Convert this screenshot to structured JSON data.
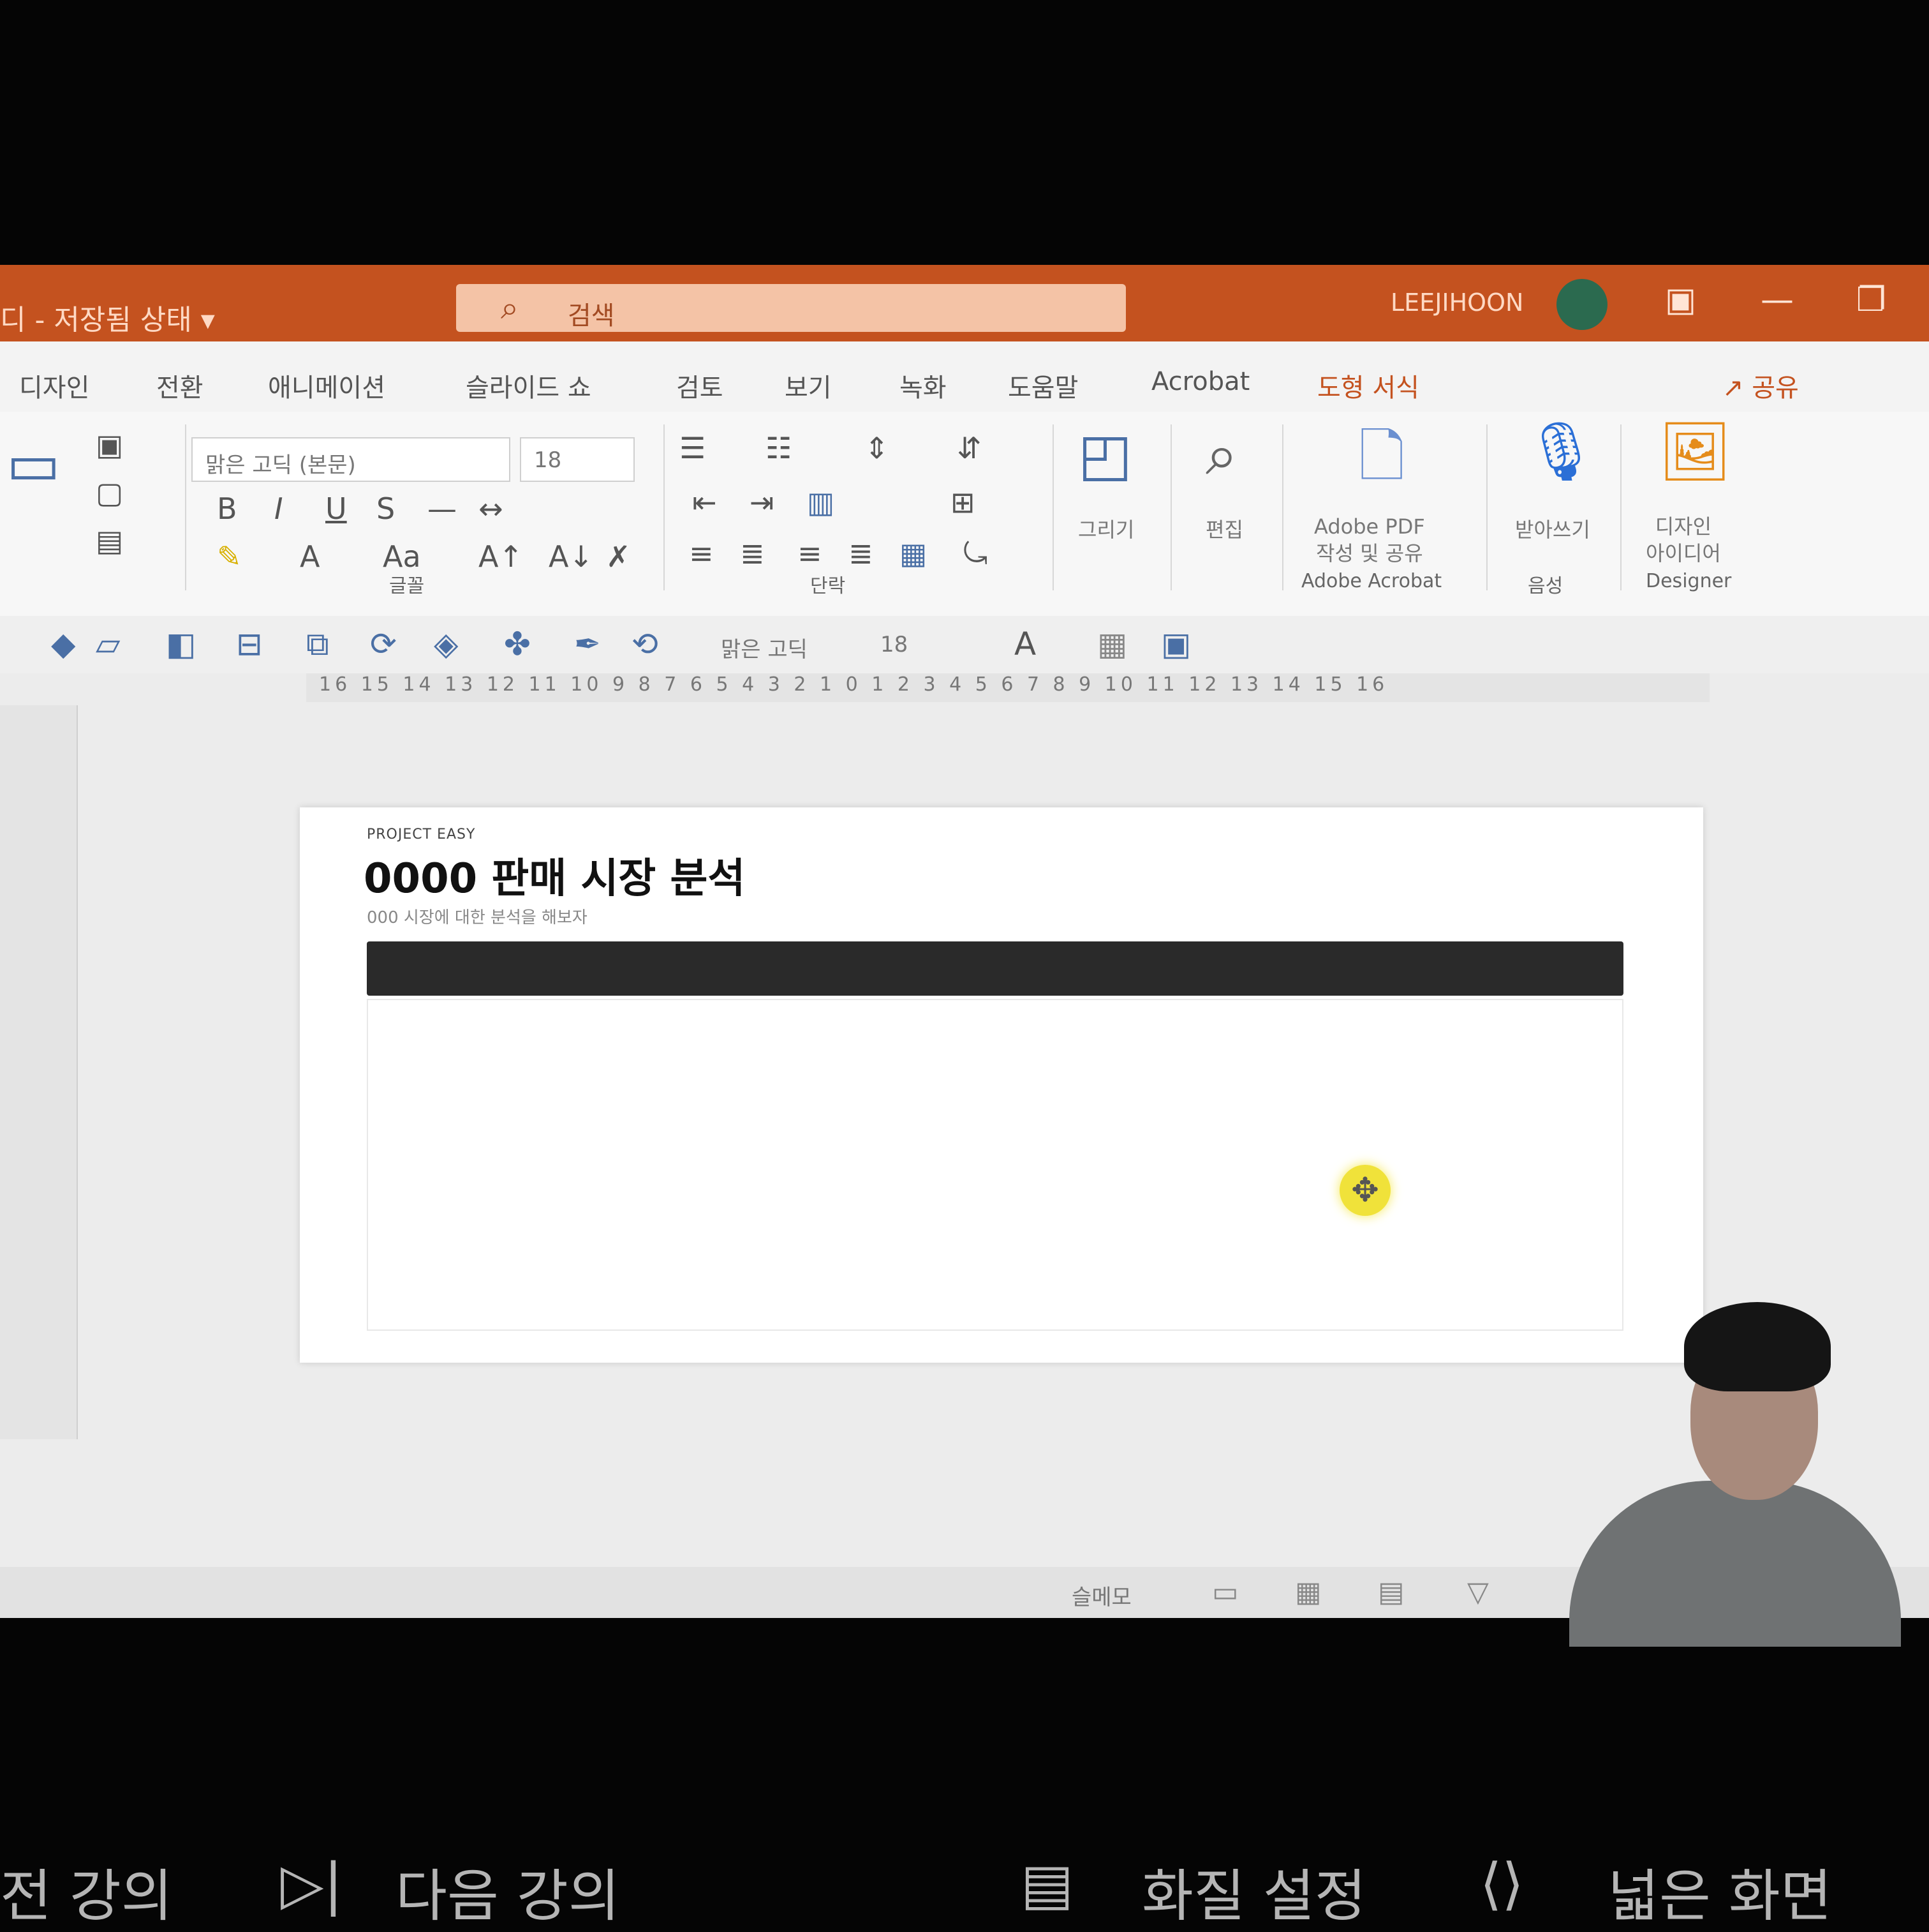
{
  "app": {
    "title": "디 - 저장됨 상태 ▾",
    "search_placeholder": "검색",
    "user_name": "LEEJIHOON",
    "share_label": "공유",
    "window_buttons": [
      "▣",
      "—",
      "❐"
    ]
  },
  "tabs": [
    {
      "label": "디자인"
    },
    {
      "label": "전환"
    },
    {
      "label": "애니메이션"
    },
    {
      "label": "슬라이드 쇼"
    },
    {
      "label": "검토"
    },
    {
      "label": "보기"
    },
    {
      "label": "녹화"
    },
    {
      "label": "도움말"
    },
    {
      "label": "Acrobat"
    },
    {
      "label": "도형 서식"
    }
  ],
  "ribbon": {
    "font_name": "맑은 고딕 (본문)",
    "font_size": "18",
    "groups": {
      "font": "글꼴",
      "paragraph": "단락",
      "adobe": "Adobe Acrobat",
      "voice": "음성",
      "designer": "Designer"
    },
    "buttons": {
      "draw": "그리기",
      "edit": "편집",
      "adobe_pdf": "Adobe PDF\n작성 및 공유",
      "dictate": "받아쓰기",
      "designer": "디자인\n아이디어"
    }
  },
  "drawing_toolbar": {
    "font_name": "맑은 고딕",
    "font_size": "18"
  },
  "ruler": {
    "ticks": "16 15 14 13 12 11 10 9 8 7 6 5 4 3 2 1 0 1 2 3 4 5 6 7 8 9 10 11 12 13 14 15 16"
  },
  "slide": {
    "kicker": "PROJECT EASY",
    "title": "0000 판매 시장 분석",
    "subtitle": "000 시장에 대한 분석을 해보자"
  },
  "status_bar": {
    "notes_label": "슬메모"
  },
  "lecture_controls": {
    "prev_label": "전 강의",
    "next_label": "다음 강의",
    "quality_label": "화질 설정",
    "wide_label": "넓은 화면"
  }
}
